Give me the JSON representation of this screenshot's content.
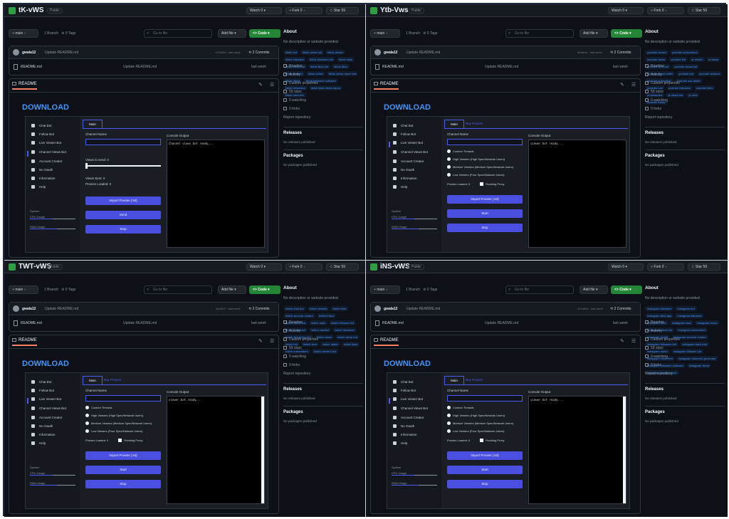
{
  "common": {
    "visibility": "Public",
    "watch": "Watch",
    "watch_count": "0",
    "fork": "Fork",
    "fork_count": "0",
    "star": "Star",
    "star_count": "59",
    "branch": "main",
    "branch_count": "1 Branch",
    "tags": "0 Tags",
    "search_placeholder": "Go to file",
    "add_file": "Add file",
    "code": "Code",
    "commit_author": "gwala12",
    "commit_message": "Update README.md",
    "commit_meta": "· last week",
    "commit_count": "2 Commits",
    "file_name": "README.md",
    "file_message": "Update README.md",
    "file_time": "last week",
    "readme_tab": "README",
    "download": "DOWNLOAD",
    "about": "About",
    "about_desc": "No description or website provided.",
    "readme_link": "Readme",
    "activity": "Activity",
    "custom_props": "Custom properties",
    "stars": "59 stars",
    "watching": "0 watching",
    "forks": "0 forks",
    "report": "Report repository",
    "releases": "Releases",
    "no_releases": "No releases published",
    "packages": "Packages",
    "no_packages": "No packages published",
    "tab_main": "Main",
    "tab_proxy": "Buy Proxies",
    "channel_name": "Channel Name",
    "console_output": "Console Output",
    "system": "System",
    "cpu": "CPU Usage",
    "ram": "RAM Usage",
    "sidebar": [
      "Chat Bot",
      "Follow Bot",
      "Live Viewer Bot",
      "Channel Views Bot",
      "Account Creator",
      "No Oauth",
      "Information",
      "Help"
    ]
  },
  "panels": [
    {
      "name": "tK-vWS",
      "commit_hash": "b7f2d03",
      "topics": [
        "tiktok bot",
        "tiktok views bot",
        "tiktok viewer",
        "tiktok followers",
        "tiktok followers bot",
        "tiktok hack",
        "tiktok views bot",
        "tiktok likes bot",
        "tiktok likes",
        "tiktok viewbot",
        "tiktok follow",
        "tiktok views report bot",
        "tiktok views",
        "tiktok followers software",
        "tiktok viewerbot",
        "tiktok hack views report",
        "tiktok hack bot"
      ],
      "console_text": "Channel views bot ready...",
      "views_label": "Views to send: 0",
      "views_sent": "Views Sent: 0",
      "proxies_loaded": "Proxies Loaded: 0",
      "btn1": "Import Proxies (.txt)",
      "btn2": "Send",
      "btn3": "Stop"
    },
    {
      "name": "Ytb-Vws",
      "commit_hash": "5f0ab1e",
      "topics": [
        "youtube viewer",
        "youtube subscribers",
        "youtube views",
        "youtube bot",
        "yt viewer",
        "yt views",
        "youtube view bot",
        "youtube views bot",
        "youtube views traffic",
        "youtube bot",
        "youtube viewbot",
        "youtube subscriber",
        "youtube sub adder",
        "youtube tool",
        "youtube followers",
        "youtube likes",
        "yt viewerbot",
        "yt views bot",
        "yt view",
        "youtube follow"
      ],
      "console_text": "viewer bot ready...",
      "radio_custom": "Custom Threads",
      "radio_high": "High Viewers (High Spec/Network Users)",
      "radio_medium": "Medium Viewers (Medium Spec/Network Users)",
      "radio_low": "Low Viewers (Poor Spec/Network Users)",
      "proxies_loaded": "Proxies Loaded: 0",
      "rotating": "Rotating Proxy",
      "btn1": "Import Proxies (.txt)",
      "btn2": "Start",
      "btn3": "Stop"
    },
    {
      "name": "TWT-vWS",
      "commit_hash": "3ac9e7f",
      "topics": [
        "twitch chat bot",
        "twitch viewers",
        "twitch bots",
        "twitch account creator",
        "twitch follow",
        "twitch follow bot",
        "twitch hack",
        "twitch follower bot",
        "twitch viewerbot",
        "twitch viewbot",
        "twitch followers",
        "twitch streaming bot",
        "twitch views",
        "twitch views bot",
        "twitch bot",
        "twitch view",
        "twitch adder",
        "twitch likes",
        "twitch subscribers",
        "twitch viewers bot"
      ],
      "console_text": "viewer bot ready...",
      "radio_custom": "Custom Threads",
      "radio_high": "High Viewers (High Spec/Network Users)",
      "radio_medium": "Medium Viewers (Medium Spec/Network Users)",
      "radio_low": "Low Viewers (Poor Spec/Network Users)",
      "proxies_loaded": "Proxies Loaded: 0",
      "rotating": "Rotating Proxy",
      "btn1": "Import Proxies (.txt)",
      "btn2": "Start",
      "btn3": "Stop"
    },
    {
      "name": "iNS-vWS",
      "commit_hash": "e21d9b4",
      "topics": [
        "instagram followers",
        "instagram bot",
        "instagram likes app",
        "instagram followers",
        "instagram likes",
        "instagram hack",
        "instagram views",
        "instagram views bot",
        "instagram subscribers",
        "instagram reddit",
        "instagram account creator",
        "instagram followers bot",
        "instagram hack tool",
        "instagram adder",
        "instagram follower bot",
        "instagram viewerbot",
        "instagram followers generator",
        "instagram followers software",
        "instagram views",
        "instagram bot for report"
      ],
      "console_text": "viewer bot ready...",
      "radio_custom": "Custom Threads",
      "radio_high": "High Viewers (High Spec/Network Users)",
      "radio_medium": "Medium Viewers (Medium Spec/Network Users)",
      "radio_low": "Low Viewers (Poor Spec/Network Users)",
      "proxies_loaded": "Proxies Loaded: 0",
      "rotating": "Rotating Proxy",
      "btn1": "Import Proxies (.txt)",
      "btn2": "Start",
      "btn3": "Stop"
    }
  ],
  "colors": {
    "accent": "#4a4fe0",
    "link": "#4493f8",
    "code_button": "#238636",
    "bg": "#0d1117"
  }
}
